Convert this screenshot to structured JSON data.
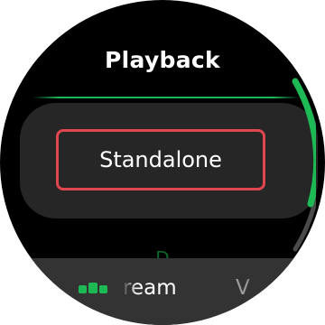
{
  "header": {
    "title": "Playback"
  },
  "options": {
    "selected_label": "Standalone",
    "next_label_partial": "D"
  },
  "bottom_bar": {
    "primary_label_partial": "ream",
    "secondary_label_partial": "V",
    "icon": "bars-icon"
  },
  "colors": {
    "accent": "#1db954",
    "focus_border": "#e0464d",
    "card": "#262626",
    "bottom_bar": "#333333"
  },
  "scroll": {
    "position_fraction": 0.1,
    "visible_fraction": 0.75
  }
}
